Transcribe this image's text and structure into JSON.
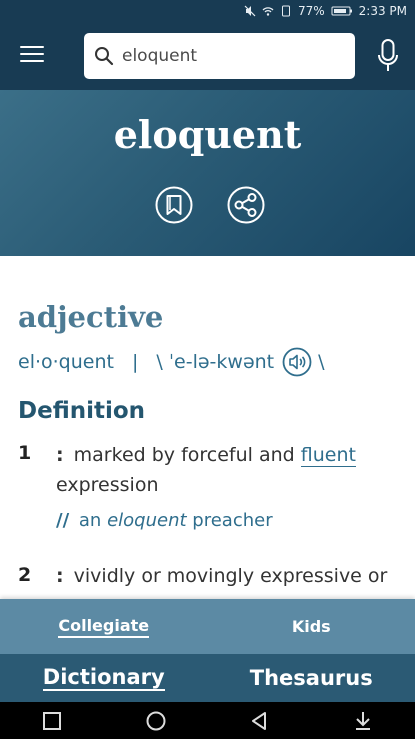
{
  "status_bar": {
    "battery": "77%",
    "time": "2:33 PM"
  },
  "search": {
    "value": "eloquent",
    "placeholder": "eloquent"
  },
  "entry": {
    "word": "eloquent",
    "part_of_speech": "adjective",
    "syllables": "el·o·quent",
    "separator": "|",
    "pron_open": "\\ ˈe-lə-kwənt",
    "pron_close": "\\",
    "definition_heading": "Definition",
    "senses": [
      {
        "num": "1",
        "colon": ":",
        "text_before": "marked by forceful and",
        "link": "fluent",
        "text_after": "expression",
        "example_marker": "//",
        "example_before": "an",
        "example_italic": "eloquent",
        "example_after": "preacher"
      },
      {
        "num": "2",
        "colon": ":",
        "text": "vividly or movingly expressive or"
      }
    ]
  },
  "bottom_tabs": [
    {
      "label": "Collegiate",
      "active": true
    },
    {
      "label": "Kids",
      "active": false
    }
  ],
  "dict_tabs": [
    {
      "label": "Dictionary",
      "active": true
    },
    {
      "label": "Thesaurus",
      "active": false
    }
  ],
  "icons": {
    "menu": "hamburger-icon",
    "search": "search-icon",
    "mic": "microphone-icon",
    "bookmark": "bookmark-icon",
    "share": "share-icon",
    "audio": "speaker-icon"
  },
  "colors": {
    "header": "#183b53",
    "accent": "#2f6e8d",
    "tabs": "#5c8aa4"
  }
}
